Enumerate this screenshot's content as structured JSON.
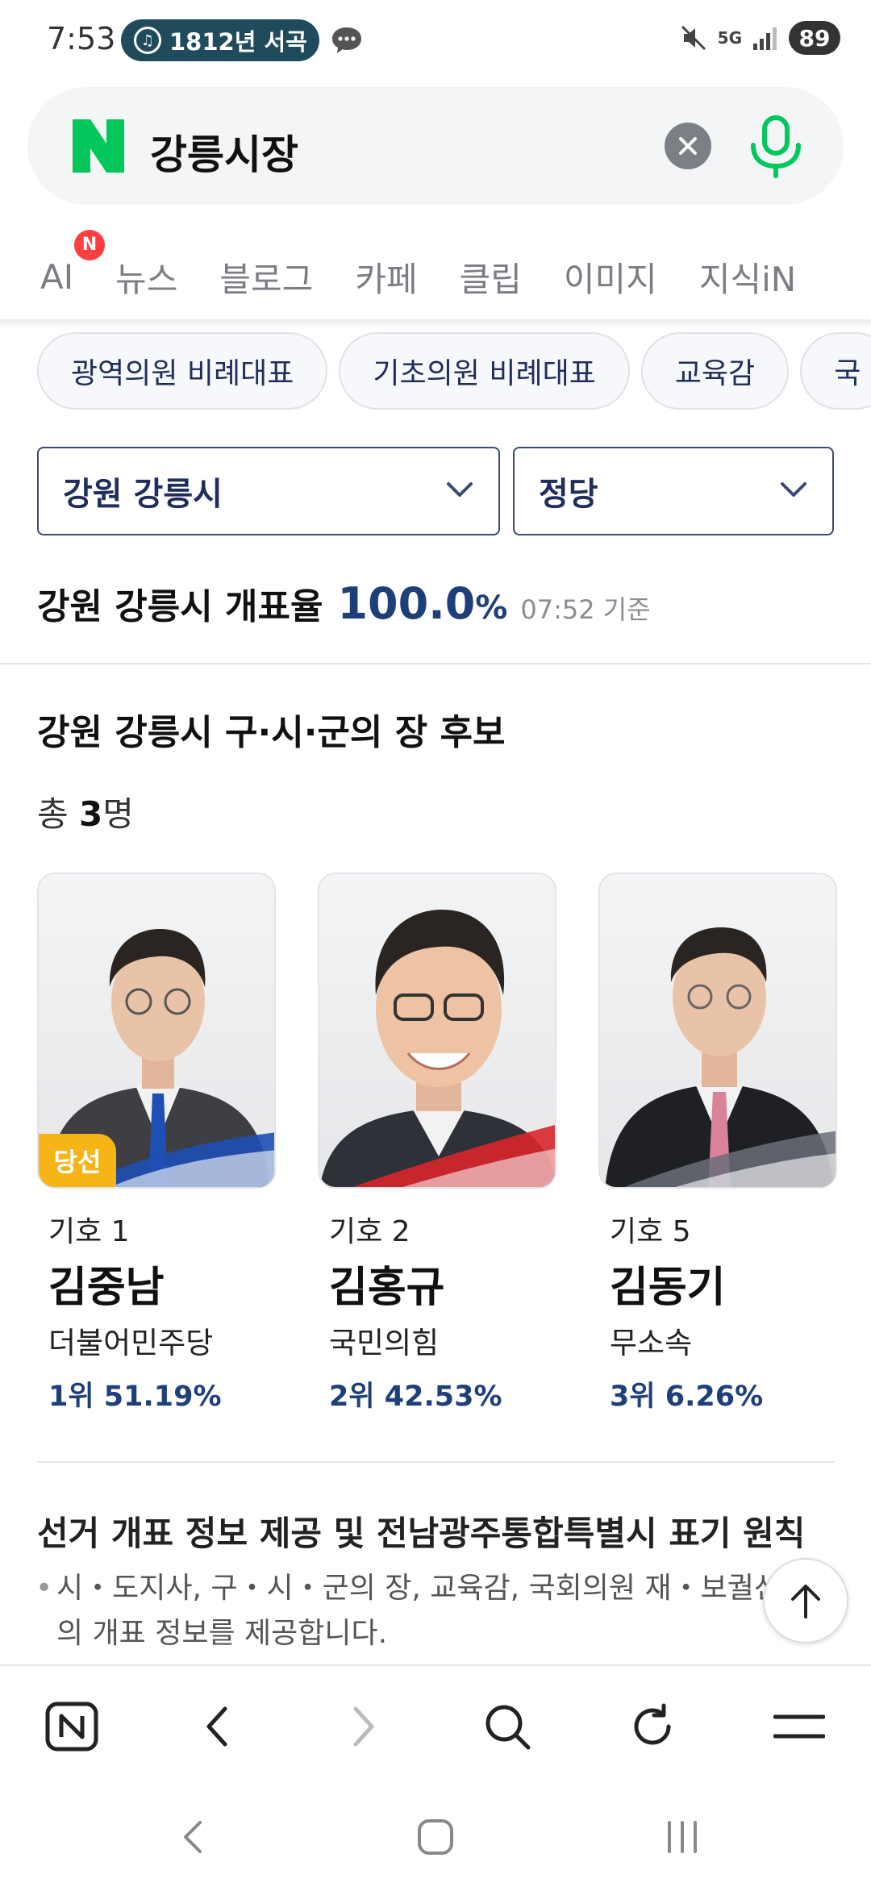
{
  "status_bar": {
    "time": "7:53",
    "media_pill": "1812년 서곡",
    "battery": "89",
    "network": "5G"
  },
  "search": {
    "query": "강릉시장"
  },
  "tabs": [
    {
      "label": "AI",
      "badge": "N"
    },
    {
      "label": "뉴스"
    },
    {
      "label": "블로그"
    },
    {
      "label": "카페"
    },
    {
      "label": "클립"
    },
    {
      "label": "이미지"
    },
    {
      "label": "지식iN"
    }
  ],
  "chips": [
    "광역의원 비례대표",
    "기초의원 비례대표",
    "교육감",
    "국"
  ],
  "filters": {
    "region": "강원 강릉시",
    "party": "정당"
  },
  "count_rate": {
    "title": "강원 강릉시 개표율",
    "value": "100.0",
    "unit": "%",
    "time": "07:52 기준"
  },
  "section": {
    "title": "강원 강릉시 구·시·군의 장 후보",
    "total_prefix": "총 ",
    "total_count": "3",
    "total_suffix": "명"
  },
  "candidates": [
    {
      "symbol": "기호 1",
      "name": "김중남",
      "party": "더불어민주당",
      "result": "1위 51.19%",
      "winner": "당선",
      "color": "#1e4fb5"
    },
    {
      "symbol": "기호 2",
      "name": "김홍규",
      "party": "국민의힘",
      "result": "2위 42.53%",
      "color": "#d8262c"
    },
    {
      "symbol": "기호 5",
      "name": "김동기",
      "party": "무소속",
      "result": "3위 6.26%",
      "color": "#555a66"
    }
  ],
  "notice": {
    "title": "선거 개표 정보 제공 및 전남광주통합특별시 표기 원칙",
    "body": "시・도지사, 구・시・군의 장, 교육감, 국회의원 재・보궐선거의 개표 정보를 제공합니다."
  },
  "colors": {
    "naver_green": "#03c75a",
    "accent_navy": "#1f3f7a",
    "winner_gold": "#f6b417"
  }
}
